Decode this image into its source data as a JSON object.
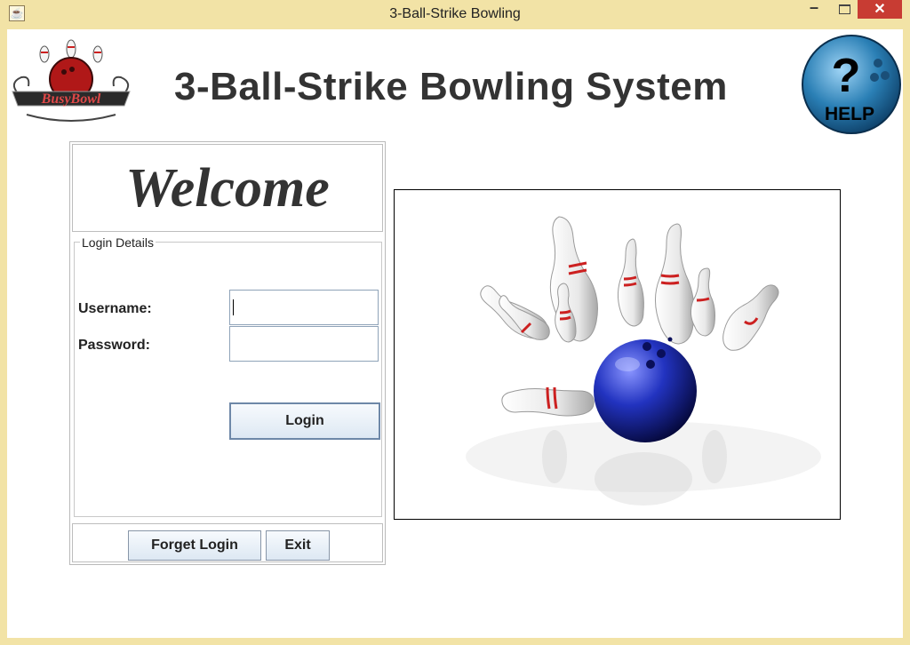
{
  "window": {
    "title": "3-Ball-Strike Bowling",
    "icon": "java-cup-icon",
    "controls": {
      "minimize": "minimize-icon",
      "maximize": "maximize-icon",
      "close": "close-icon",
      "close_color": "#c83c33"
    }
  },
  "header": {
    "logo_text": "BusyBowl",
    "app_title": "3-Ball-Strike Bowling System",
    "help_label": "HELP",
    "help_symbol": "?"
  },
  "welcome": {
    "text": "Welcome"
  },
  "login": {
    "group_title": "Login Details",
    "username_label": "Username:",
    "username_value": "",
    "password_label": "Password:",
    "password_value": "",
    "login_button": "Login"
  },
  "footer": {
    "forget_button": "Forget Login",
    "exit_button": "Exit"
  },
  "image": {
    "subject": "bowling-strike-illustration"
  },
  "colors": {
    "frame": "#f2e3a6",
    "ball": "#1e2bb0",
    "pin_stripe": "#cc2020",
    "help_badge": "#2a7fb5"
  }
}
